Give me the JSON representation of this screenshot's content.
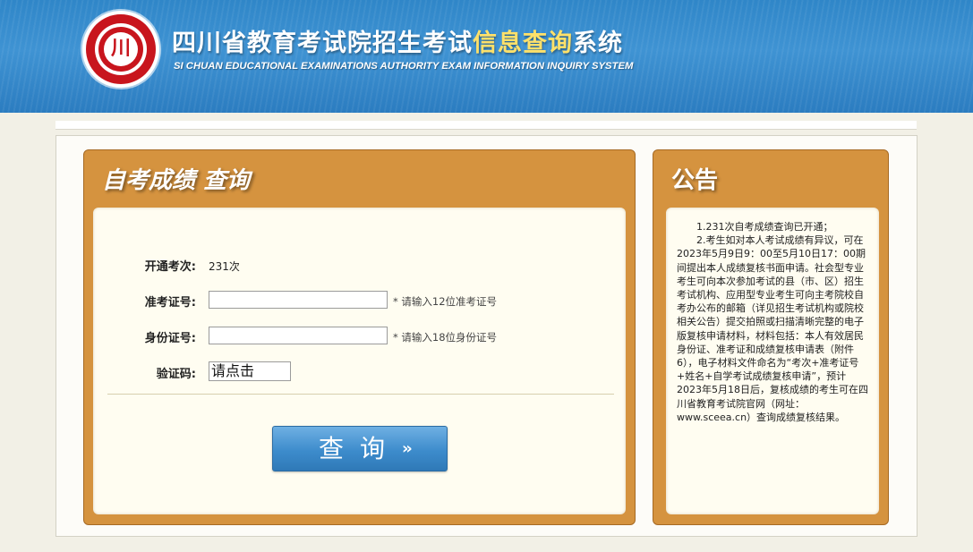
{
  "header": {
    "title_main": "四川省教育考试院招生考试",
    "title_highlight": "信息查询",
    "title_tail": "系统",
    "subtitle": "SI CHUAN EDUCATIONAL EXAMINATIONS AUTHORITY EXAM INFORMATION INQUIRY SYSTEM",
    "logo_glyph": "川",
    "logo_colors": {
      "red": "#c8151d",
      "white": "#ffffff"
    }
  },
  "query_panel": {
    "title": "自考成绩  查询",
    "exam_session_label": "开通考次:",
    "exam_session_value": "231次",
    "admission_label": "准考证号:",
    "admission_value": "",
    "admission_hint": "* 请输入12位准考证号",
    "id_label": "身份证号:",
    "id_value": "",
    "id_hint": "* 请输入18位身份证号",
    "captcha_label": "验证码:",
    "captcha_text": "请点击",
    "submit_label": "查询",
    "submit_arrow": "››"
  },
  "notice_panel": {
    "title": "公告",
    "paragraphs": [
      "1.231次自考成绩查询已开通；",
      "2.考生如对本人考试成绩有异议，可在2023年5月9日9：00至5月10日17：00期间提出本人成绩复核书面申请。社会型专业考生可向本次参加考试的县（市、区）招生考试机构、应用型专业考生可向主考院校自考办公布的邮箱（详见招生考试机构或院校相关公告）提交拍照或扫描清晰完整的电子版复核申请材料，材料包括：本人有效居民身份证、准考证和成绩复核申请表（附件6），电子材料文件命名为“考次+准考证号+姓名+自学考试成绩复核申请”，预计2023年5月18日后，复核成绩的考生可在四川省教育考试院官网（网址：www.sceea.cn）查询成绩复核结果。"
    ]
  },
  "colors": {
    "header_blue": "#3f93d3",
    "panel_orange": "#d5933f",
    "panel_inner": "#fffdf1",
    "button_blue": "#3d8ccc",
    "title_highlight": "#ffe16a"
  }
}
